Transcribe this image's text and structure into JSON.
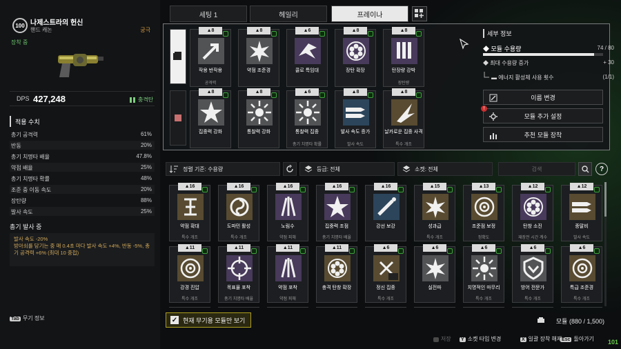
{
  "character": {
    "level": "100",
    "name": "나제스트라의 헌신",
    "weapon_type": "핸드 캐논",
    "rarity": "궁극",
    "equipped_label": "장착 중"
  },
  "dps": {
    "label": "DPS",
    "value": "427,248",
    "ammo_type": "충격탄"
  },
  "applied_stats": {
    "title": "적용 수치",
    "rows": [
      {
        "name": "총기 공격력",
        "value": "61%"
      },
      {
        "name": "반동",
        "value": "20%"
      },
      {
        "name": "총기 치명타 배율",
        "value": "47.8%"
      },
      {
        "name": "약점 배율",
        "value": "25%"
      },
      {
        "name": "총기 치명타 확률",
        "value": "48%"
      },
      {
        "name": "조준 중 이동 속도",
        "value": "20%"
      },
      {
        "name": "장탄량",
        "value": "88%"
      },
      {
        "name": "발사 속도",
        "value": "25%"
      }
    ]
  },
  "firing": {
    "title": "총기 발사 중",
    "text": "발사 속도 -20%\n방아쇠를 당기는 중 매 0.4초 마다 발사 속도 +4%, 반동 -5%, 총기 공격력 +6% (최대 10 중첩)"
  },
  "weapon_info": {
    "key": "Tab",
    "label": "무기 정보"
  },
  "tabs": [
    {
      "label": "세팅 1",
      "active": false
    },
    {
      "label": "헤일리",
      "active": false
    },
    {
      "label": "프레이나",
      "active": true
    }
  ],
  "equipped": {
    "row1": [
      {
        "cost": "8",
        "name": "작용 반작용",
        "sub": "공격력",
        "icon": "arrow-icon",
        "color": "#b8b8b8"
      },
      {
        "cost": "8",
        "name": "약점 조준경",
        "sub": "",
        "icon": "burst-icon",
        "color": "#b8b8b8"
      },
      {
        "cost": "6",
        "name": "콜로 특임대",
        "sub": "",
        "icon": "bird-icon",
        "color": "#9a70c8"
      },
      {
        "cost": "8",
        "name": "장탄 확장",
        "sub": "",
        "icon": "cylinder-icon",
        "color": "#9a70c8"
      },
      {
        "cost": "8",
        "name": "탄장량 강박",
        "sub": "장탄량",
        "icon": "ammo-icon",
        "color": "#9a70c8"
      }
    ],
    "row2": [
      {
        "cost": "8",
        "name": "집중력 강화",
        "sub": "",
        "icon": "star-icon",
        "color": "#b8b8b8"
      },
      {
        "cost": "8",
        "name": "통찰력 강화",
        "sub": "",
        "icon": "starburst-icon",
        "color": "#b8b8b8"
      },
      {
        "cost": "6",
        "name": "통찰력 집중",
        "sub": "총기 치명타 확률",
        "icon": "starburst-icon",
        "color": "#b8b8b8"
      },
      {
        "cost": "8",
        "name": "발사 속도 증가",
        "sub": "발사 속도",
        "icon": "bullets-icon",
        "color": "#4a90c8"
      },
      {
        "cost": "8",
        "name": "날카로운 집중 사격",
        "sub": "특수 개조",
        "icon": "spike-icon",
        "color": "#c8a050"
      }
    ]
  },
  "detail": {
    "title": "세부 정보",
    "capacity_label": "모듈 수용량",
    "capacity_value": "74 / 80",
    "capacity_fraction": 0.925,
    "max_label": "최대 수용량 증가",
    "max_value": "+ 30",
    "energy_label": "에너지 활성체 사용 횟수",
    "energy_value": "(1/1)",
    "buttons": [
      "이름 변경",
      "모듈 추가 설정",
      "추천 모듈 장착"
    ]
  },
  "filters": {
    "sort": "정렬 기준: 수용량",
    "grade": "등급: 전체",
    "socket": "소켓: 전체",
    "search_placeholder": "검색",
    "help": "?"
  },
  "inventory": {
    "row1": [
      {
        "cost": "16",
        "name": "약점 확대",
        "sub": "특수 개조",
        "icon": "rune-icon",
        "color": "#c8a050"
      },
      {
        "cost": "16",
        "name": "도파민 활성",
        "sub": "특수 개조",
        "icon": "swirl-icon",
        "color": "#c8a050"
      },
      {
        "cost": "16",
        "name": "노림수",
        "sub": "약점 피해",
        "icon": "claw-icon",
        "color": "#9a70c8"
      },
      {
        "cost": "16",
        "name": "집중력 조점",
        "sub": "총기 치명타 배율",
        "icon": "star-icon",
        "color": "#9a70c8"
      },
      {
        "cost": "16",
        "name": "강선 보강",
        "sub": "",
        "icon": "pen-icon",
        "color": "#4a90c8"
      },
      {
        "cost": "15",
        "name": "성과급",
        "sub": "특수 개조",
        "icon": "burst-icon",
        "color": "#c8a050"
      },
      {
        "cost": "13",
        "name": "조준점 보정",
        "sub": "정확도",
        "icon": "target-icon",
        "color": "#c8a050"
      },
      {
        "cost": "12",
        "name": "탄창 소진",
        "sub": "재장전 시간 계수",
        "icon": "cylinder-icon",
        "color": "#9a70c8"
      },
      {
        "cost": "12",
        "name": "종말비",
        "sub": "발사 속도",
        "icon": "bullets-icon",
        "color": "#c8a050"
      }
    ],
    "row2": [
      {
        "cost": "11",
        "name": "강경 진압",
        "sub": "특수 개조",
        "icon": "target-icon",
        "color": "#c8a050"
      },
      {
        "cost": "11",
        "name": "목표물 포착",
        "sub": "총기 치명타 배율",
        "icon": "crosshair-icon",
        "color": "#9a70c8"
      },
      {
        "cost": "11",
        "name": "약점 포착",
        "sub": "약점 피해",
        "icon": "claw-icon",
        "color": "#9a70c8"
      },
      {
        "cost": "11",
        "name": "충격 탄창 확장",
        "sub": "",
        "icon": "cylinder-icon",
        "color": "#c8a050"
      },
      {
        "cost": "6",
        "name": "정신 집중",
        "sub": "특수 개조",
        "icon": "x2-icon",
        "color": "#c8a050"
      },
      {
        "cost": "6",
        "name": "실전파",
        "sub": "",
        "icon": "burst-icon",
        "color": "#b8b8b8"
      },
      {
        "cost": "6",
        "name": "치명적인 마무리",
        "sub": "특수 개조",
        "icon": "starburst-icon",
        "color": "#b8b8b8"
      },
      {
        "cost": "6",
        "name": "방어 전문가",
        "sub": "특수 개조",
        "icon": "shield-icon",
        "color": "#b8b8b8"
      },
      {
        "cost": "6",
        "name": "특급 조준경",
        "sub": "특수 개조",
        "icon": "target-icon",
        "color": "#c8a050"
      }
    ]
  },
  "bottom": {
    "only_equip": "현재 무기용 모듈만 보기",
    "module_count": "모듈 (880 / 1,500)",
    "hints": [
      {
        "key": "",
        "label": "저장",
        "dim": true
      },
      {
        "key": "Y",
        "label": "소켓 타입 변경",
        "dim": false
      },
      {
        "key": "X",
        "label": "일괄 장착 해제",
        "dim": false
      },
      {
        "key": "Esc",
        "label": "돌아가기",
        "dim": false
      }
    ],
    "corner": "101"
  },
  "colors": {
    "accent_green": "#6ccf4c",
    "rarity_gold": "#e0a040"
  }
}
